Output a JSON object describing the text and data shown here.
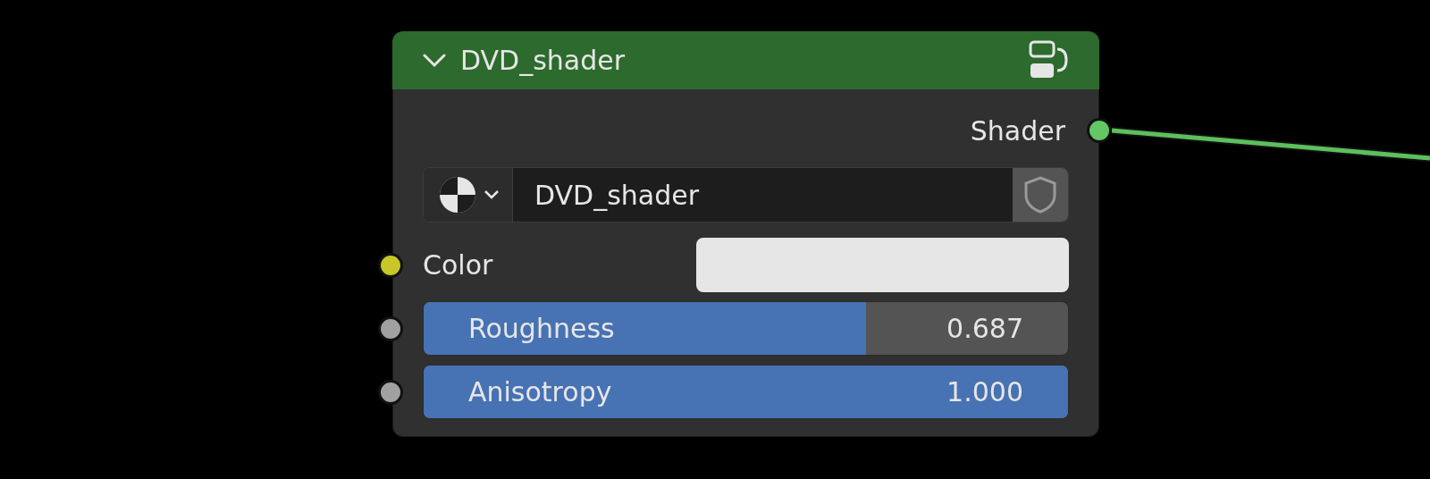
{
  "node": {
    "title": "DVD_shader",
    "expanded": true,
    "outputs": [
      {
        "label": "Shader",
        "kind": "shader"
      }
    ],
    "material": {
      "name": "DVD_shader"
    },
    "inputs": [
      {
        "kind": "color",
        "label": "Color",
        "color": "#e6e6e6"
      },
      {
        "kind": "slider",
        "label": "Roughness",
        "level": 0.687,
        "reading": "0.687"
      },
      {
        "kind": "slider",
        "label": "Anisotropy",
        "level": 1,
        "reading": "1.000"
      }
    ]
  }
}
